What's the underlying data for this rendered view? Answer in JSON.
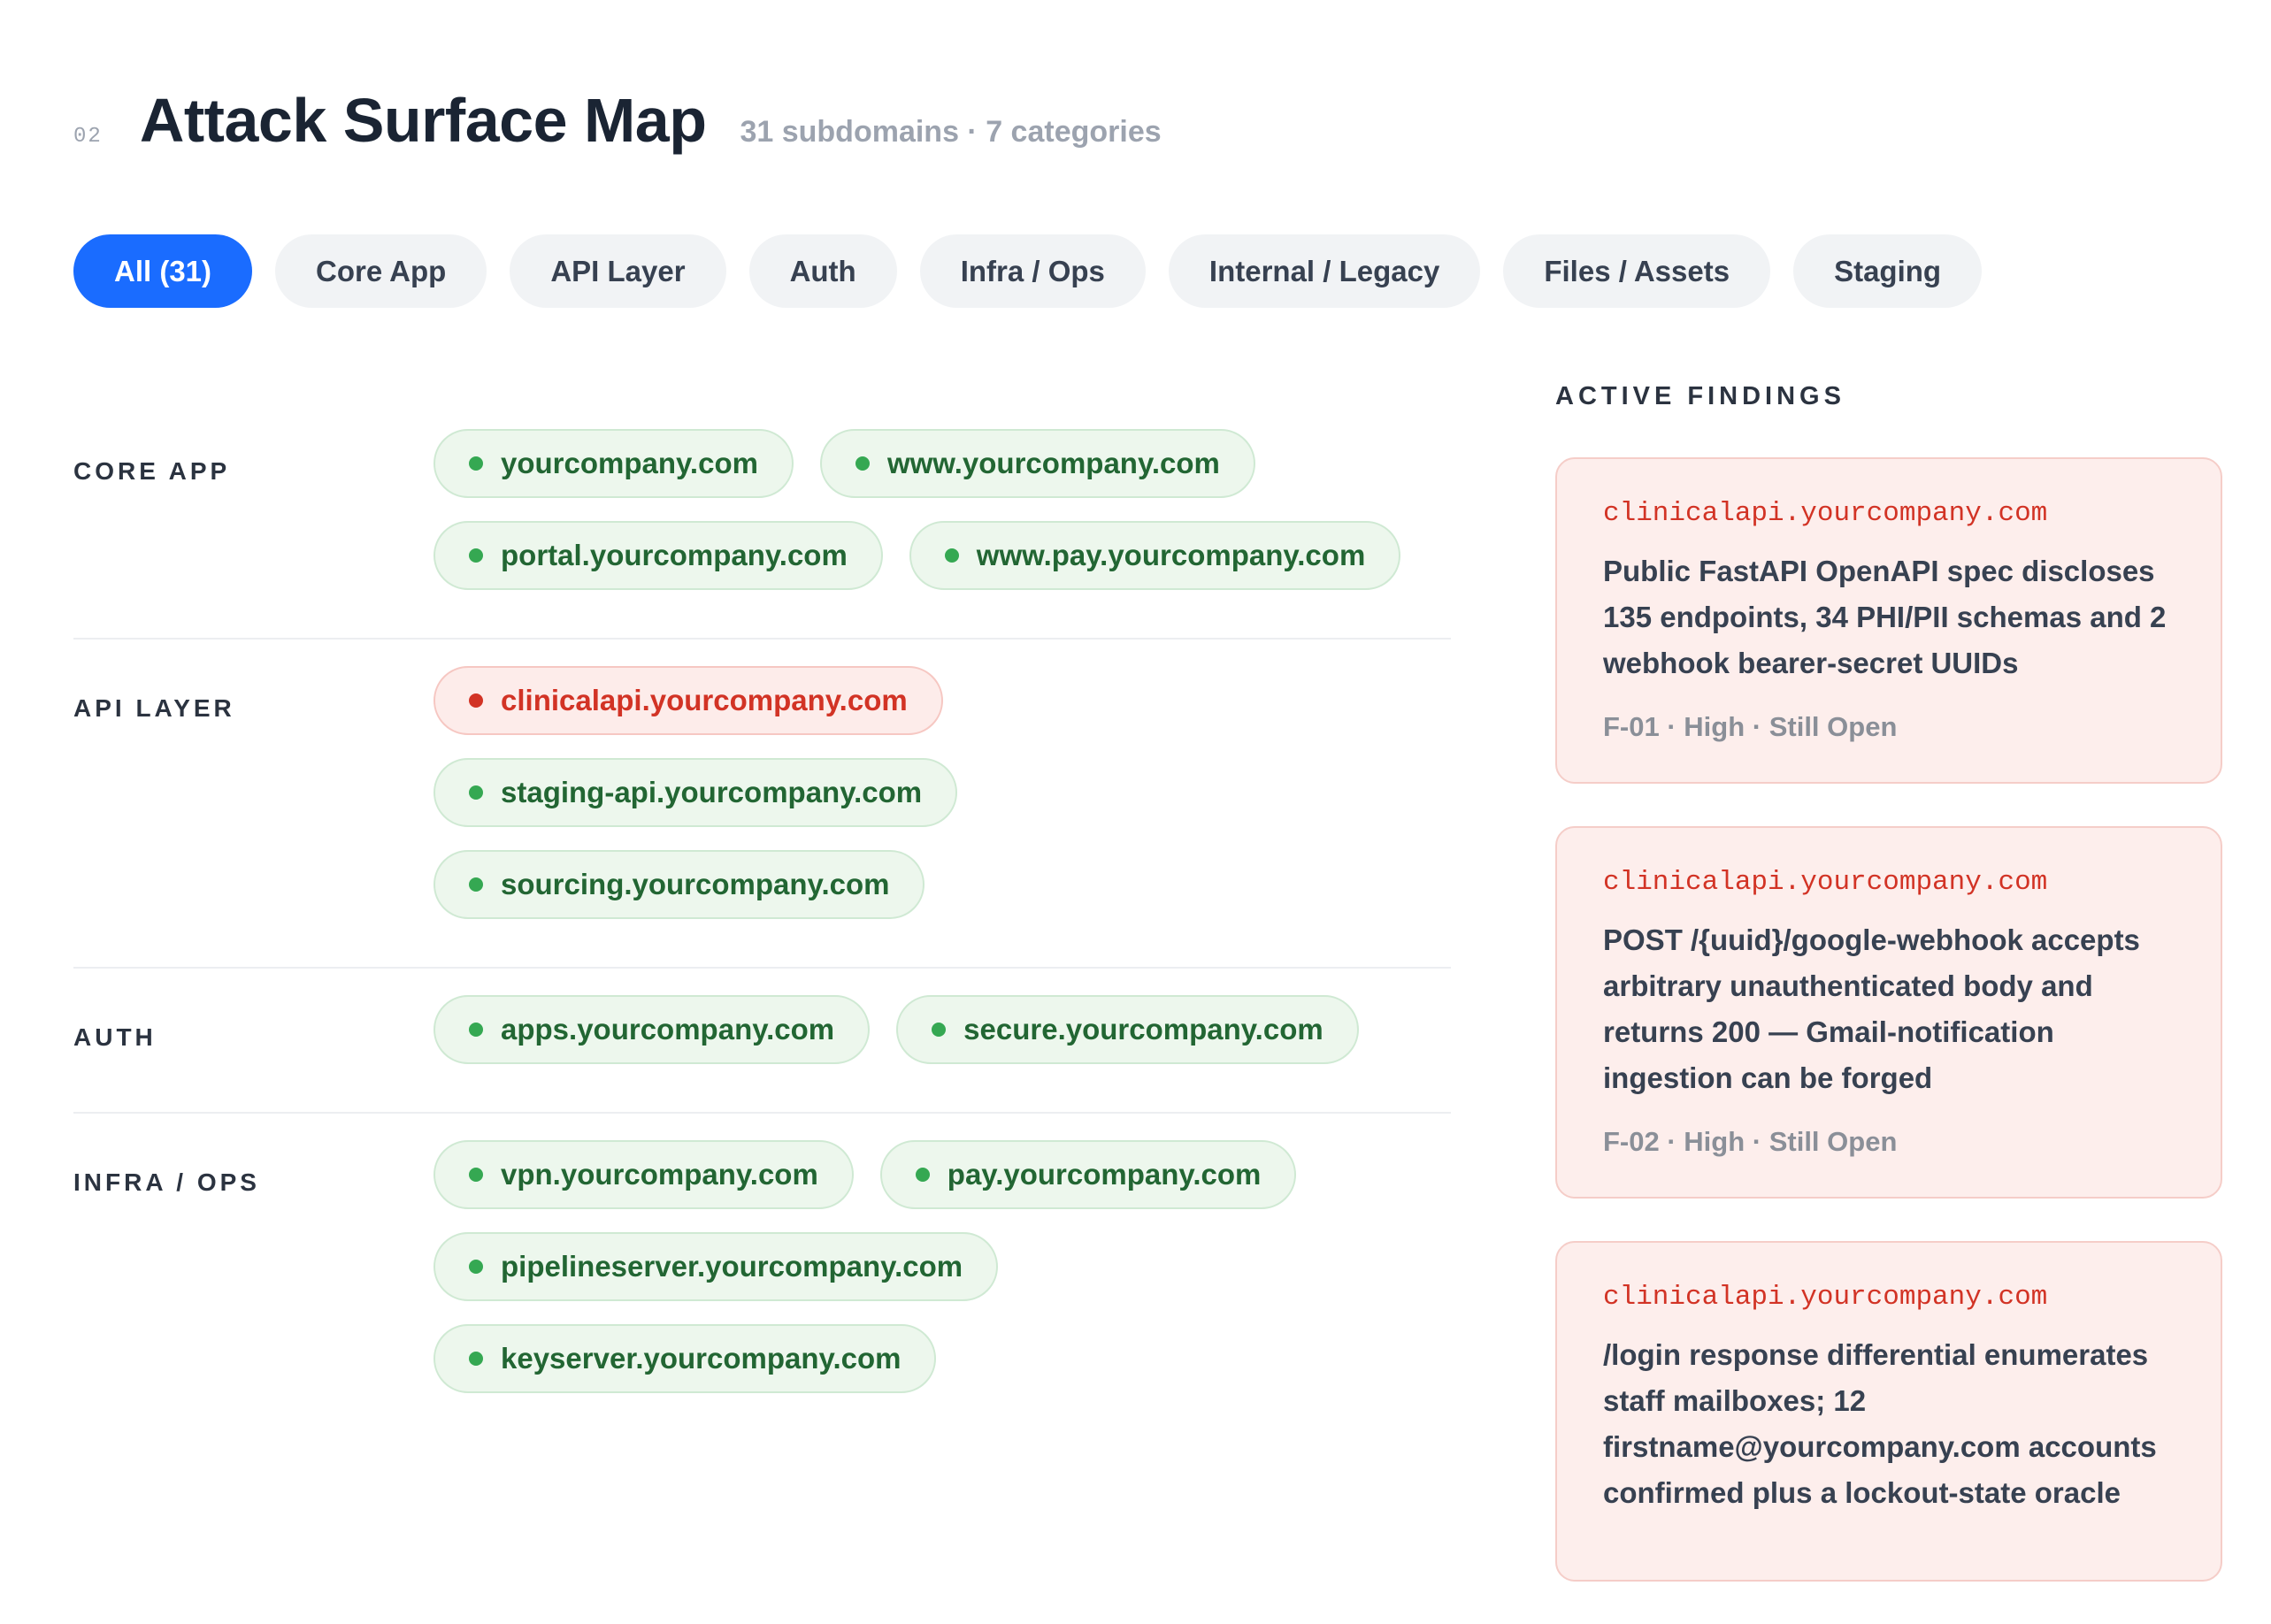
{
  "header": {
    "section_number": "02",
    "title": "Attack Surface Map",
    "stats": "31 subdomains · 7 categories"
  },
  "tabs": [
    {
      "label": "All (31)",
      "active": true
    },
    {
      "label": "Core App",
      "active": false
    },
    {
      "label": "API Layer",
      "active": false
    },
    {
      "label": "Auth",
      "active": false
    },
    {
      "label": "Infra / Ops",
      "active": false
    },
    {
      "label": "Internal / Legacy",
      "active": false
    },
    {
      "label": "Files / Assets",
      "active": false
    },
    {
      "label": "Staging",
      "active": false
    }
  ],
  "categories": [
    {
      "label": "CORE APP",
      "hosts": [
        {
          "name": "yourcompany.com",
          "status": "ok"
        },
        {
          "name": "www.yourcompany.com",
          "status": "ok"
        },
        {
          "name": "portal.yourcompany.com",
          "status": "ok"
        },
        {
          "name": "www.pay.yourcompany.com",
          "status": "ok"
        }
      ]
    },
    {
      "label": "API LAYER",
      "hosts": [
        {
          "name": "clinicalapi.yourcompany.com",
          "status": "risk"
        },
        {
          "name": "staging-api.yourcompany.com",
          "status": "ok"
        },
        {
          "name": "sourcing.yourcompany.com",
          "status": "ok"
        }
      ]
    },
    {
      "label": "AUTH",
      "hosts": [
        {
          "name": "apps.yourcompany.com",
          "status": "ok"
        },
        {
          "name": "secure.yourcompany.com",
          "status": "ok"
        }
      ]
    },
    {
      "label": "INFRA / OPS",
      "hosts": [
        {
          "name": "vpn.yourcompany.com",
          "status": "ok"
        },
        {
          "name": "pay.yourcompany.com",
          "status": "ok"
        },
        {
          "name": "pipelineserver.yourcompany.com",
          "status": "ok"
        },
        {
          "name": "keyserver.yourcompany.com",
          "status": "ok"
        }
      ]
    }
  ],
  "findings": {
    "title": "ACTIVE FINDINGS",
    "items": [
      {
        "host": "clinicalapi.yourcompany.com",
        "description": "Public FastAPI OpenAPI spec discloses 135 endpoints, 34 PHI/PII schemas and 2 webhook bearer-secret UUIDs",
        "meta": "F-01 · High · Still Open"
      },
      {
        "host": "clinicalapi.yourcompany.com",
        "description": "POST /{uuid}/google-webhook accepts arbitrary unauthenticated body and returns 200 — Gmail-notification ingestion can be forged",
        "meta": "F-02 · High · Still Open"
      },
      {
        "host": "clinicalapi.yourcompany.com",
        "description": "/login response differential enumerates staff mailboxes; 12 firstname@yourcompany.com accounts confirmed plus a lockout-state oracle",
        "meta": ""
      }
    ]
  },
  "colors": {
    "accent": "#1a6cff",
    "ok_chip_bg": "#edf7ed",
    "ok_text": "#226633",
    "ok_dot": "#35a852",
    "risk_bg": "#fdecea",
    "risk_text": "#d23325"
  }
}
